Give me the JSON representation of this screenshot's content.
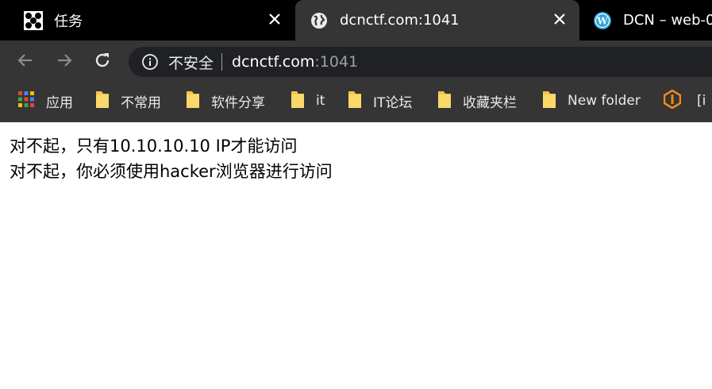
{
  "tabs": [
    {
      "title": "任务",
      "icon": "dots-logo-icon",
      "active": false
    },
    {
      "title": "dcnctf.com:1041",
      "icon": "globe-icon",
      "active": true
    },
    {
      "title": "DCN – web-0",
      "icon": "wordpress-icon",
      "active": false
    }
  ],
  "omnibox": {
    "security_label": "不安全",
    "host": "dcnctf.com",
    "port": ":1041"
  },
  "bookmarks": [
    {
      "label": "应用",
      "icon": "apps-grid-icon"
    },
    {
      "label": "不常用",
      "icon": "folder-icon"
    },
    {
      "label": "软件分享",
      "icon": "folder-icon"
    },
    {
      "label": "it",
      "icon": "folder-icon"
    },
    {
      "label": "IT论坛",
      "icon": "folder-icon"
    },
    {
      "label": "收藏夹栏",
      "icon": "folder-icon"
    },
    {
      "label": "New folder",
      "icon": "folder-icon"
    },
    {
      "label": "[i",
      "icon": "orange-logo-icon"
    }
  ],
  "page": {
    "line1": "对不起，只有10.10.10.10 IP才能访问",
    "line2": "对不起，你必须使用hacker浏览器进行访问"
  },
  "colors": {
    "tabstrip": "#000000",
    "toolbar": "#353535",
    "omnibox": "#202124",
    "folder": "#f6c548",
    "wordpress": "#2d9fd9",
    "orange_logo": "#f08a1c"
  }
}
